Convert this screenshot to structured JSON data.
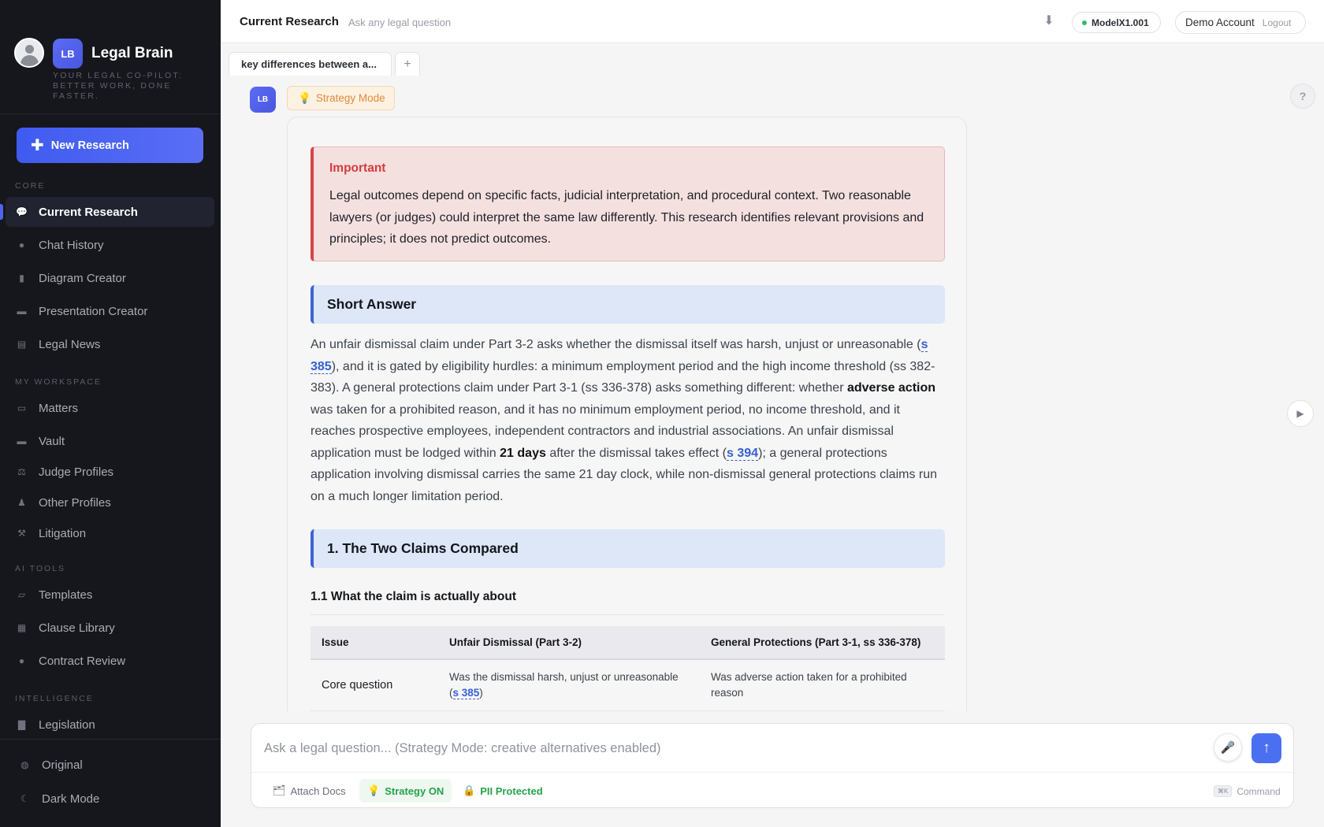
{
  "sidebar": {
    "brand_initials": "LB",
    "brand_name": "Legal Brain",
    "tagline": "Your legal co-pilot: better work, done faster.",
    "new_research_label": "New Research",
    "sections": {
      "core": "Core",
      "workspace": "My Workspace",
      "ai_tools": "AI Tools",
      "intelligence": "Intelligence"
    },
    "items": [
      {
        "label": "Current Research",
        "icon": "chat-bubble-icon"
      },
      {
        "label": "Chat History",
        "icon": "history-icon"
      },
      {
        "label": "Diagram Creator",
        "icon": "chart-icon"
      },
      {
        "label": "Presentation Creator",
        "icon": "presentation-icon"
      },
      {
        "label": "Legal News",
        "icon": "newspaper-icon"
      },
      {
        "label": "Matters",
        "icon": "briefcase-icon"
      },
      {
        "label": "Vault",
        "icon": "vault-icon"
      },
      {
        "label": "Judge Profiles",
        "icon": "scales-icon"
      },
      {
        "label": "Other Profiles",
        "icon": "person-icon"
      },
      {
        "label": "Litigation",
        "icon": "gavel-icon"
      },
      {
        "label": "Templates",
        "icon": "template-icon"
      },
      {
        "label": "Clause Library",
        "icon": "book-icon"
      },
      {
        "label": "Contract Review",
        "icon": "search-icon"
      },
      {
        "label": "Legislation",
        "icon": "building-icon"
      }
    ],
    "bottom": {
      "original_label": "Original",
      "dark_mode_label": "Dark Mode"
    }
  },
  "header": {
    "title": "Current Research",
    "subtitle": "Ask any legal question",
    "model": "ModelX1.001",
    "account": "Demo Account",
    "logout": "Logout"
  },
  "tabs": [
    {
      "label": "key differences between a..."
    }
  ],
  "tab_add": "+",
  "message": {
    "avatar": "LB",
    "mode_badge": "Strategy Mode",
    "important_title": "Important",
    "important_body": "Legal outcomes depend on specific facts, judicial interpretation, and procedural context. Two reasonable lawyers (or judges) could interpret the same law differently. This research identifies relevant provisions and principles; it does not predict outcomes.",
    "short_answer_heading": "Short Answer",
    "short_answer": {
      "p1": "An unfair dismissal claim under Part 3-2 asks whether the dismissal itself was harsh, unjust or unreasonable (",
      "cite1": "s 385",
      "p2": "), and it is gated by eligibility hurdles: a minimum employment period and the high income threshold (ss 382-383). A general protections claim under Part 3-1 (ss 336-378) asks something different: whether ",
      "b1": "adverse action",
      "p3": " was taken for a prohibited reason, and it has no minimum employment period, no income threshold, and it reaches prospective employees, independent contractors and industrial associations. An unfair dismissal application must be lodged within ",
      "b2": "21 days",
      "p4": " after the dismissal takes effect (",
      "cite2": "s 394",
      "p5": "); a general protections application involving dismissal carries the same 21 day clock, while non-dismissal general protections claims run on a much longer limitation period."
    },
    "section1_heading": "1. The Two Claims Compared",
    "subsection_heading": "1.1 What the claim is actually about",
    "table": {
      "headers": [
        "Issue",
        "Unfair Dismissal (Part 3-2)",
        "General Protections (Part 3-1, ss 336-378)"
      ],
      "row1": {
        "issue": "Core question",
        "ud_text": "Was the dismissal harsh, unjust or unreasonable (",
        "ud_cite": "s 385",
        "ud_close": ")",
        "gp": "Was adverse action taken for a prohibited reason"
      }
    }
  },
  "input": {
    "placeholder": "Ask a legal question... (Strategy Mode: creative alternatives enabled)",
    "attach_label": "Attach Docs",
    "strategy_label": "Strategy ON",
    "pii_label": "PII Protected",
    "command_key": "⌘K",
    "command_label": "Command"
  },
  "colors": {
    "accent": "#4a6ff0",
    "sidebar_bg": "#16171c",
    "important_red": "#d94444",
    "section_blue": "#3d62d6",
    "strategy_orange": "#e08b3a",
    "success_green": "#26a34a"
  }
}
